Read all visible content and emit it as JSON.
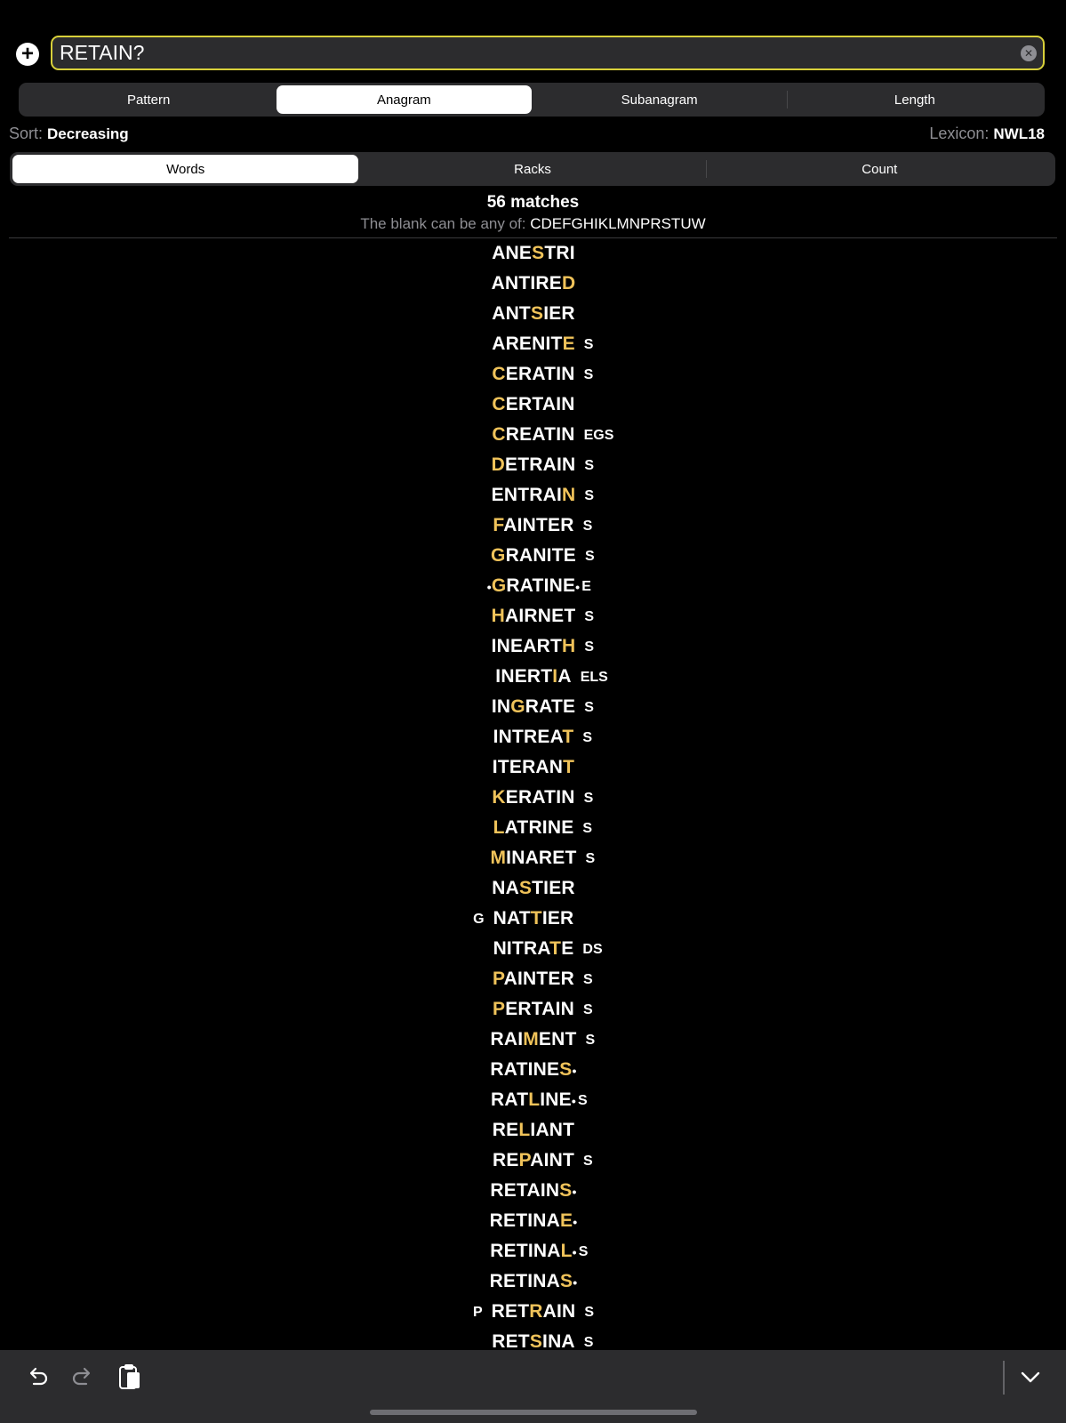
{
  "search": {
    "value": "RETAIN?"
  },
  "mode_tabs": [
    "Pattern",
    "Anagram",
    "Subanagram",
    "Length"
  ],
  "mode_active": 1,
  "sort": {
    "label": "Sort:",
    "value": "Decreasing"
  },
  "lexicon": {
    "label": "Lexicon:",
    "value": "NWL18"
  },
  "view_tabs": [
    "Words",
    "Racks",
    "Count"
  ],
  "view_active": 0,
  "summary": {
    "matches": "56 matches",
    "blank_label": "The blank can be any of:",
    "blank_letters": "CDEFGHIKLMNPRSTUW"
  },
  "colors": {
    "highlight": "#f0c35a",
    "search_border": "#d8d03a"
  },
  "words": [
    {
      "pre": "ANE",
      "hl": "S",
      "post": "TRI",
      "front": "",
      "back": "",
      "dot_front": false,
      "dot_back": false
    },
    {
      "pre": "ANTIRE",
      "hl": "D",
      "post": "",
      "front": "",
      "back": "",
      "dot_front": false,
      "dot_back": false
    },
    {
      "pre": "ANT",
      "hl": "S",
      "post": "IER",
      "front": "",
      "back": "",
      "dot_front": false,
      "dot_back": false
    },
    {
      "pre": "ARENIT",
      "hl": "E",
      "post": "",
      "front": "",
      "back": "S",
      "dot_front": false,
      "dot_back": false
    },
    {
      "pre": "",
      "hl": "C",
      "post": "ERATIN",
      "front": "",
      "back": "S",
      "dot_front": false,
      "dot_back": false
    },
    {
      "pre": "",
      "hl": "C",
      "post": "ERTAIN",
      "front": "",
      "back": "",
      "dot_front": false,
      "dot_back": false
    },
    {
      "pre": "",
      "hl": "C",
      "post": "REATIN",
      "front": "",
      "back": "EGS",
      "dot_front": false,
      "dot_back": false
    },
    {
      "pre": "",
      "hl": "D",
      "post": "ETRAIN",
      "front": "",
      "back": "S",
      "dot_front": false,
      "dot_back": false
    },
    {
      "pre": "ENTRAI",
      "hl": "N",
      "post": "",
      "front": "",
      "back": "S",
      "dot_front": false,
      "dot_back": false
    },
    {
      "pre": "",
      "hl": "F",
      "post": "AINTER",
      "front": "",
      "back": "S",
      "dot_front": false,
      "dot_back": false
    },
    {
      "pre": "",
      "hl": "G",
      "post": "RANITE",
      "front": "",
      "back": "S",
      "dot_front": false,
      "dot_back": false
    },
    {
      "pre": "",
      "hl": "G",
      "post": "RATINE",
      "front": "",
      "back": "E",
      "dot_front": true,
      "dot_back": true
    },
    {
      "pre": "",
      "hl": "H",
      "post": "AIRNET",
      "front": "",
      "back": "S",
      "dot_front": false,
      "dot_back": false
    },
    {
      "pre": "INEART",
      "hl": "H",
      "post": "",
      "front": "",
      "back": "S",
      "dot_front": false,
      "dot_back": false
    },
    {
      "pre": "INERT",
      "hl": "I",
      "post": "A",
      "front": "",
      "back": "ELS",
      "dot_front": false,
      "dot_back": false
    },
    {
      "pre": "IN",
      "hl": "G",
      "post": "RATE",
      "front": "",
      "back": "S",
      "dot_front": false,
      "dot_back": false
    },
    {
      "pre": "INTREA",
      "hl": "T",
      "post": "",
      "front": "",
      "back": "S",
      "dot_front": false,
      "dot_back": false
    },
    {
      "pre": "ITERAN",
      "hl": "T",
      "post": "",
      "front": "",
      "back": "",
      "dot_front": false,
      "dot_back": false
    },
    {
      "pre": "",
      "hl": "K",
      "post": "ERATIN",
      "front": "",
      "back": "S",
      "dot_front": false,
      "dot_back": false
    },
    {
      "pre": "",
      "hl": "L",
      "post": "ATRINE",
      "front": "",
      "back": "S",
      "dot_front": false,
      "dot_back": false
    },
    {
      "pre": "",
      "hl": "M",
      "post": "INARET",
      "front": "",
      "back": "S",
      "dot_front": false,
      "dot_back": false
    },
    {
      "pre": "NA",
      "hl": "S",
      "post": "TIER",
      "front": "",
      "back": "",
      "dot_front": false,
      "dot_back": false
    },
    {
      "pre": "NAT",
      "hl": "T",
      "post": "IER",
      "front": "G",
      "back": "",
      "dot_front": false,
      "dot_back": false
    },
    {
      "pre": "NITRA",
      "hl": "T",
      "post": "E",
      "front": "",
      "back": "DS",
      "dot_front": false,
      "dot_back": false
    },
    {
      "pre": "",
      "hl": "P",
      "post": "AINTER",
      "front": "",
      "back": "S",
      "dot_front": false,
      "dot_back": false
    },
    {
      "pre": "",
      "hl": "P",
      "post": "ERTAIN",
      "front": "",
      "back": "S",
      "dot_front": false,
      "dot_back": false
    },
    {
      "pre": "RAI",
      "hl": "M",
      "post": "ENT",
      "front": "",
      "back": "S",
      "dot_front": false,
      "dot_back": false
    },
    {
      "pre": "RATINE",
      "hl": "S",
      "post": "",
      "front": "",
      "back": "",
      "dot_front": false,
      "dot_back": true
    },
    {
      "pre": "RAT",
      "hl": "L",
      "post": "INE",
      "front": "",
      "back": "S",
      "dot_front": false,
      "dot_back": true
    },
    {
      "pre": "RE",
      "hl": "L",
      "post": "IANT",
      "front": "",
      "back": "",
      "dot_front": false,
      "dot_back": false
    },
    {
      "pre": "RE",
      "hl": "P",
      "post": "AINT",
      "front": "",
      "back": "S",
      "dot_front": false,
      "dot_back": false
    },
    {
      "pre": "RETAIN",
      "hl": "S",
      "post": "",
      "front": "",
      "back": "",
      "dot_front": false,
      "dot_back": true
    },
    {
      "pre": "RETINA",
      "hl": "E",
      "post": "",
      "front": "",
      "back": "",
      "dot_front": false,
      "dot_back": true
    },
    {
      "pre": "RETINA",
      "hl": "L",
      "post": "",
      "front": "",
      "back": "S",
      "dot_front": false,
      "dot_back": true
    },
    {
      "pre": "RETINA",
      "hl": "S",
      "post": "",
      "front": "",
      "back": "",
      "dot_front": false,
      "dot_back": true
    },
    {
      "pre": "RET",
      "hl": "R",
      "post": "AIN",
      "front": "P",
      "back": "S",
      "dot_front": false,
      "dot_back": false
    },
    {
      "pre": "RET",
      "hl": "S",
      "post": "INA",
      "front": "",
      "back": "S",
      "dot_front": false,
      "dot_back": false
    }
  ],
  "toolbar": {
    "icons": [
      "undo-icon",
      "redo-icon",
      "paste-icon",
      "chevron-down-icon"
    ]
  }
}
